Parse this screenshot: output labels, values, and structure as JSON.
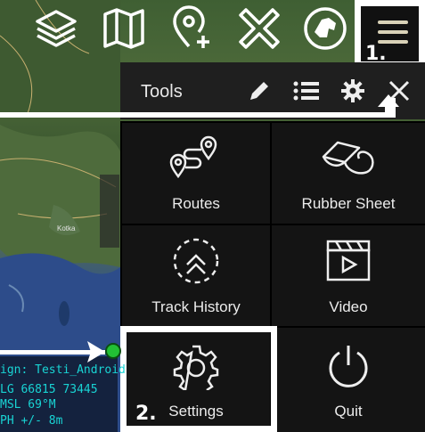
{
  "panel": {
    "title": "Tools",
    "tiles": [
      {
        "label": "Routes",
        "icon": "route-icon"
      },
      {
        "label": "Rubber Sheet",
        "icon": "rubber-sheet-icon"
      },
      {
        "label": "Track History",
        "icon": "track-history-icon"
      },
      {
        "label": "Video",
        "icon": "video-icon"
      },
      {
        "label": "Settings",
        "icon": "settings-gear-icon"
      },
      {
        "label": "Quit",
        "icon": "power-icon"
      }
    ]
  },
  "annotations": {
    "step1": "1.",
    "step2": "2."
  },
  "map_info": {
    "line1": "ign: Testi_Android",
    "line2": " LG  66815  73445",
    "line3": " MSL         69°M",
    "line4": "PH        +/- 8m"
  },
  "map_labels": {
    "city": "Kotka"
  },
  "colors": {
    "panel_bg": "#141414",
    "info_text": "#19d4d4",
    "gps_dot": "#22c035",
    "highlight": "#ffffff"
  }
}
